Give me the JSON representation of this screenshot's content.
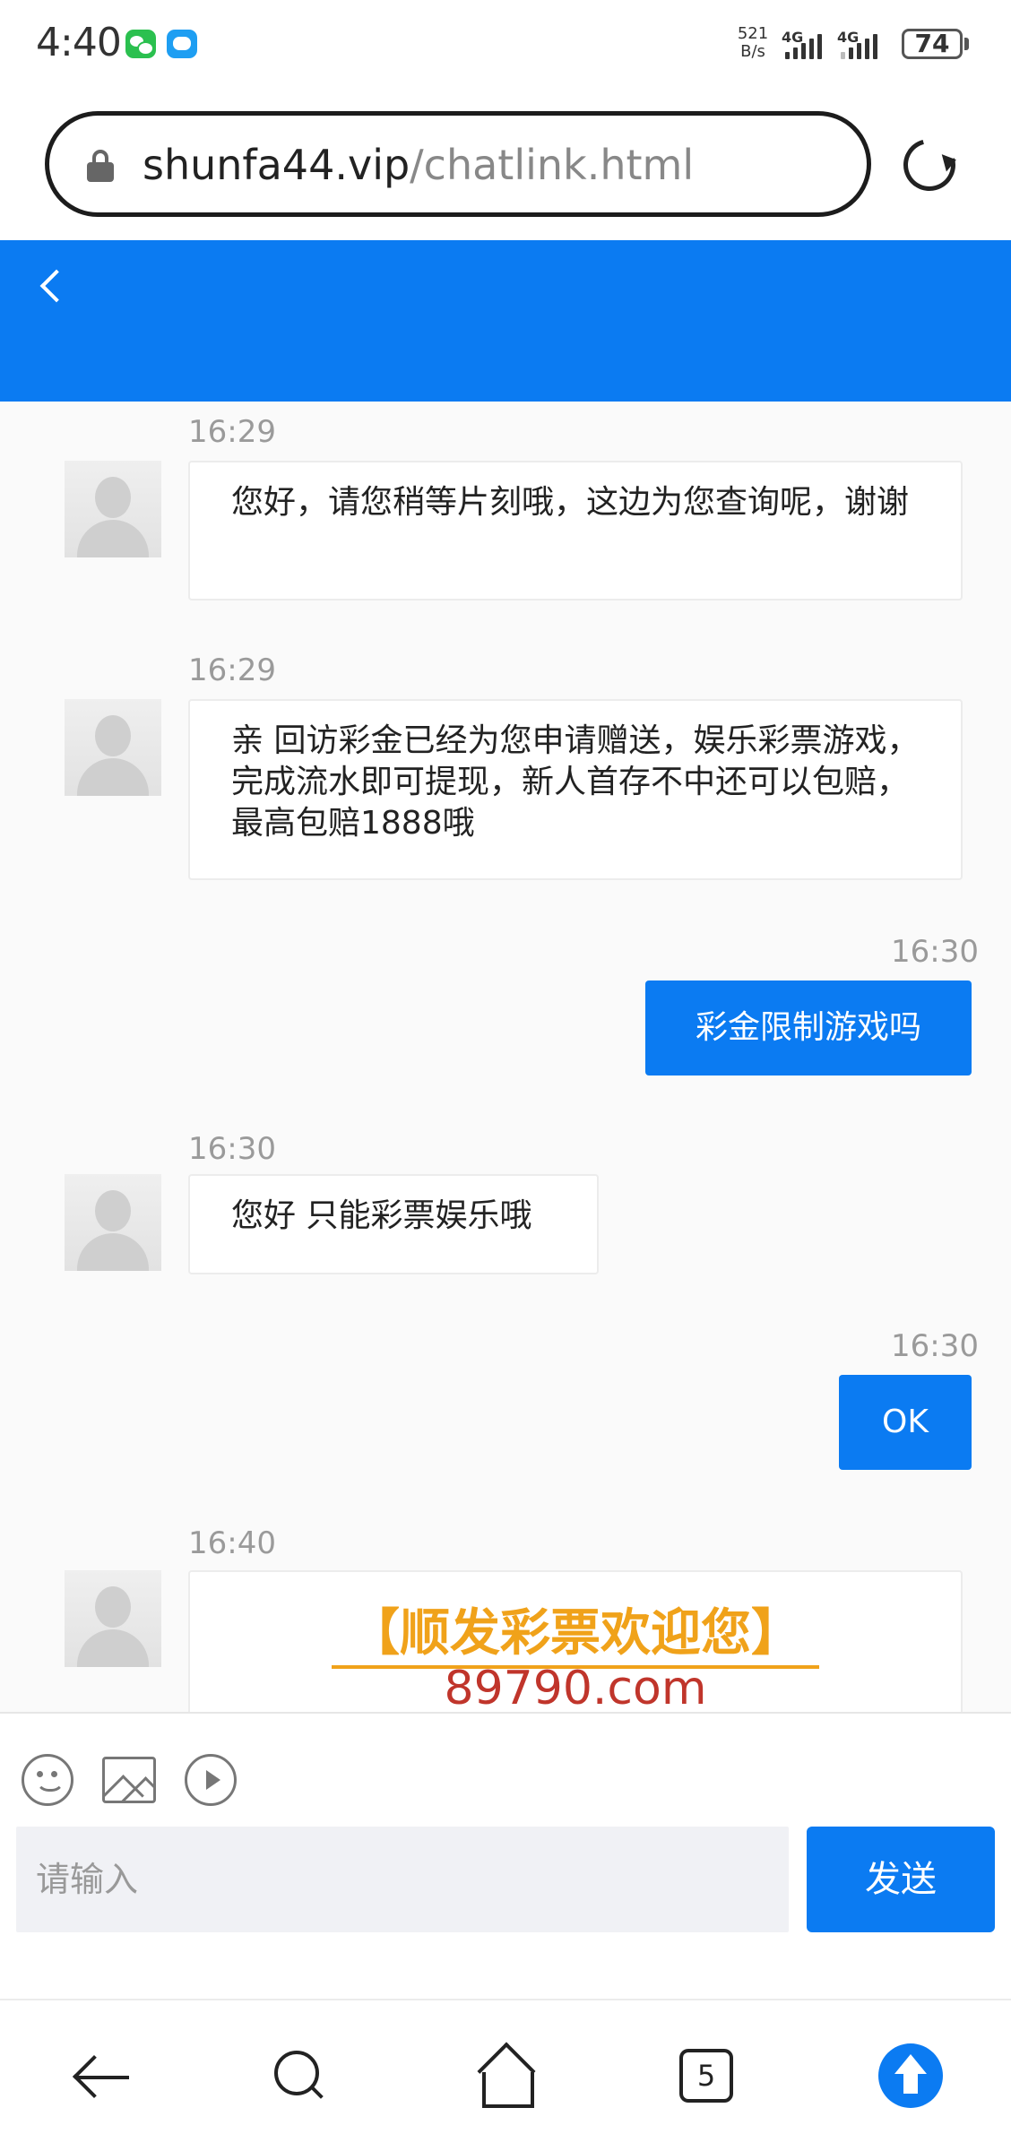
{
  "status_bar": {
    "time": "4:40",
    "net_speed_value": "521",
    "net_speed_unit": "B/s",
    "sim1_type": "4G",
    "sim2_type": "4G",
    "battery_level": "74",
    "notification_icons": [
      "wechat-icon",
      "message-icon"
    ]
  },
  "address_bar": {
    "domain": "shunfa44.vip",
    "path": "/chatlink.html"
  },
  "messages": [
    {
      "time": "16:29",
      "direction": "incoming",
      "text": "您好，请您稍等片刻哦，这边为您查询呢，谢谢"
    },
    {
      "time": "16:29",
      "direction": "incoming",
      "text": "亲 回访彩金已经为您申请赠送，娱乐彩票游戏，完成流水即可提现，新人首存不中还可以包赔，最高包赔1888哦"
    },
    {
      "time": "16:30",
      "direction": "outgoing",
      "text": "彩金限制游戏吗"
    },
    {
      "time": "16:30",
      "direction": "incoming",
      "text": "您好 只能彩票娱乐哦"
    },
    {
      "time": "16:30",
      "direction": "outgoing",
      "text": "OK"
    },
    {
      "time": "16:40",
      "direction": "incoming",
      "promo_title": "【顺发彩票欢迎您】",
      "promo_domain": "89790.com"
    }
  ],
  "composer": {
    "placeholder": "请输入",
    "send_label": "发送",
    "toolbar_icons": [
      "emoji-icon",
      "image-icon",
      "video-icon"
    ]
  },
  "bottom_nav": {
    "tab_count": "5"
  },
  "colors": {
    "accent": "#0b7bf2",
    "promo_title": "#f0a21a",
    "promo_domain": "#c0352b"
  }
}
